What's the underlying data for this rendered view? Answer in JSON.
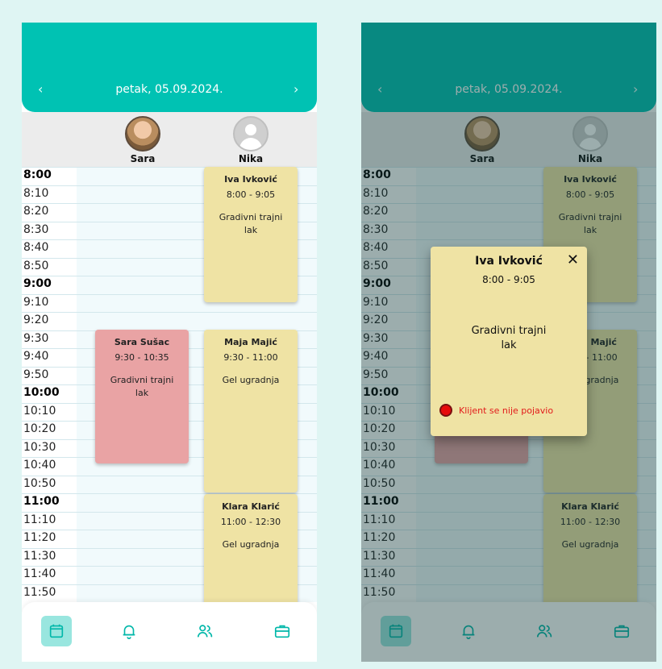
{
  "header": {
    "date": "petak, 05.09.2024.",
    "prev_icon": "‹",
    "next_icon": "›"
  },
  "staff": [
    {
      "name": "Sara"
    },
    {
      "name": "Nika"
    }
  ],
  "time_slots": [
    {
      "label": "8:00",
      "hour": true
    },
    {
      "label": "8:10",
      "hour": false
    },
    {
      "label": "8:20",
      "hour": false
    },
    {
      "label": "8:30",
      "hour": false
    },
    {
      "label": "8:40",
      "hour": false
    },
    {
      "label": "8:50",
      "hour": false
    },
    {
      "label": "9:00",
      "hour": true
    },
    {
      "label": "9:10",
      "hour": false
    },
    {
      "label": "9:20",
      "hour": false
    },
    {
      "label": "9:30",
      "hour": false
    },
    {
      "label": "9:40",
      "hour": false
    },
    {
      "label": "9:50",
      "hour": false
    },
    {
      "label": "10:00",
      "hour": true
    },
    {
      "label": "10:10",
      "hour": false
    },
    {
      "label": "10:20",
      "hour": false
    },
    {
      "label": "10:30",
      "hour": false
    },
    {
      "label": "10:40",
      "hour": false
    },
    {
      "label": "10:50",
      "hour": false
    },
    {
      "label": "11:00",
      "hour": true
    },
    {
      "label": "11:10",
      "hour": false
    },
    {
      "label": "11:20",
      "hour": false
    },
    {
      "label": "11:30",
      "hour": false
    },
    {
      "label": "11:40",
      "hour": false
    },
    {
      "label": "11:50",
      "hour": false
    }
  ],
  "appointments": [
    {
      "client": "Iva Ivković",
      "time": "8:00 - 9:05",
      "service": "Gradivni trajni lak",
      "staff": "Nika",
      "color": "#efe3a4"
    },
    {
      "client": "Sara Sušac",
      "time": "9:30 - 10:35",
      "service": "Gradivni trajni lak",
      "staff": "Sara",
      "color": "#e9a3a4"
    },
    {
      "client": "Maja Majić",
      "time": "9:30 - 11:00",
      "service": "Gel ugradnja",
      "staff": "Nika",
      "color": "#efe3a4"
    },
    {
      "client": "Klara Klarić",
      "time": "11:00 - 12:30",
      "service": "Gel ugradnja",
      "staff": "Nika",
      "color": "#efe3a4"
    }
  ],
  "modal": {
    "client": "Iva Ivković",
    "time": "8:00 - 9:05",
    "service": "Gradivni trajni lak",
    "close_icon": "✕",
    "no_show_label": "Klijent se nije pojavio"
  },
  "bottom_nav": [
    {
      "icon": "calendar-icon",
      "active": true
    },
    {
      "icon": "bell-icon",
      "active": false
    },
    {
      "icon": "users-icon",
      "active": false
    },
    {
      "icon": "briefcase-icon",
      "active": false
    }
  ],
  "colors": {
    "accent": "#00c2b3",
    "appointment_yellow": "#efe3a4",
    "appointment_pink": "#e9a3a4",
    "no_show_red": "#e21b1b"
  }
}
